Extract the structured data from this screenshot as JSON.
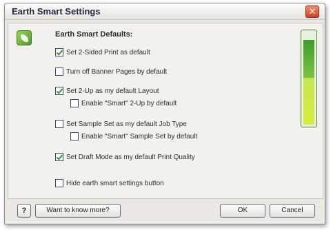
{
  "dialog": {
    "title": "Earth Smart Settings",
    "close_symbol": "✕"
  },
  "section": {
    "heading": "Earth Smart Defaults:"
  },
  "options": [
    {
      "label": "Set 2-Sided Print as default",
      "checked": true
    },
    {
      "label": "Turn off Banner Pages by default",
      "checked": false
    },
    {
      "label": "Set 2-Up as my default Layout",
      "checked": true
    },
    {
      "label": "Enable \"Smart\" 2-Up by default",
      "checked": false
    },
    {
      "label": "Set Sample Set as my default Job Type",
      "checked": false
    },
    {
      "label": "Enable \"Smart\" Sample Set by default",
      "checked": false
    },
    {
      "label": "Set Draft Mode as my default Print Quality",
      "checked": true
    },
    {
      "label": "Hide earth smart settings button",
      "checked": false
    }
  ],
  "meter": {
    "level": 0.92,
    "colors": {
      "top": "#3f9b2c",
      "bottom": "#d9ec3c"
    }
  },
  "buttons": {
    "help": "?",
    "know_more": "Want to know more?",
    "ok": "OK",
    "cancel": "Cancel"
  },
  "icons": {
    "logo": "earth-smart-leaf-icon"
  }
}
